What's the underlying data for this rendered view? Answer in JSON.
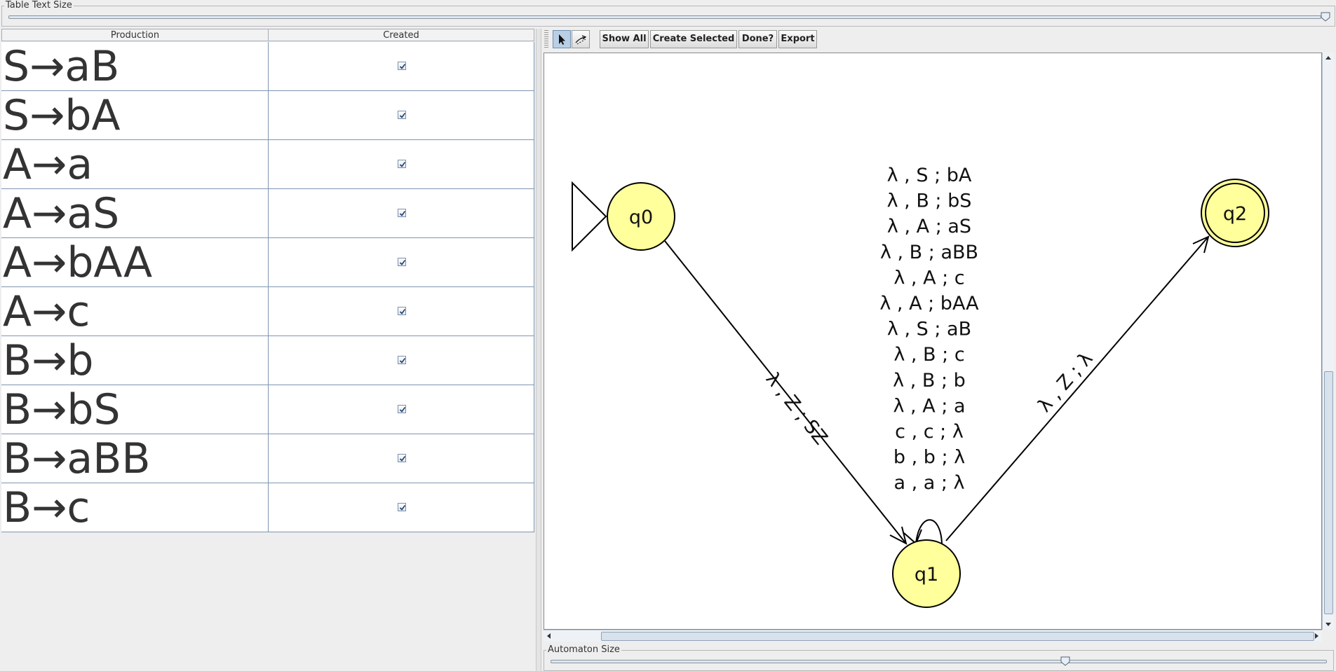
{
  "table_text_size": {
    "label": "Table Text Size",
    "value_fraction": 1.0
  },
  "table": {
    "headers": {
      "production": "Production",
      "created": "Created"
    },
    "rows": [
      {
        "production": "S→aB",
        "created": true
      },
      {
        "production": "S→bA",
        "created": true
      },
      {
        "production": "A→a",
        "created": true
      },
      {
        "production": "A→aS",
        "created": true
      },
      {
        "production": "A→bAA",
        "created": true
      },
      {
        "production": "A→c",
        "created": true
      },
      {
        "production": "B→b",
        "created": true
      },
      {
        "production": "B→bS",
        "created": true
      },
      {
        "production": "B→aBB",
        "created": true
      },
      {
        "production": "B→c",
        "created": true
      }
    ]
  },
  "toolbar": {
    "attribute_editor_icon": "pointer-arrow-icon",
    "transition_icon": "transition-arrow-icon",
    "show_all": "Show All",
    "create_selected": "Create Selected",
    "done": "Done?",
    "export": "Export"
  },
  "automaton": {
    "states": {
      "q0": "q0",
      "q1": "q1",
      "q2": "q2"
    },
    "transitions": {
      "q0_q1": "λ , Z ; SZ",
      "q1_q2": "λ , Z ; λ",
      "q1_loop": [
        "λ , S ; bA",
        "λ , B ; bS",
        "λ , A ; aS",
        "λ , B ; aBB",
        "λ , A ; c",
        "λ , A ; bAA",
        "λ , S ; aB",
        "λ , B ; c",
        "λ , B ; b",
        "λ , A ; a",
        "c , c ; λ",
        "b , b ; λ",
        "a , a ; λ"
      ]
    }
  },
  "automaton_size": {
    "label": "Automaton Size",
    "value_fraction": 0.66
  }
}
